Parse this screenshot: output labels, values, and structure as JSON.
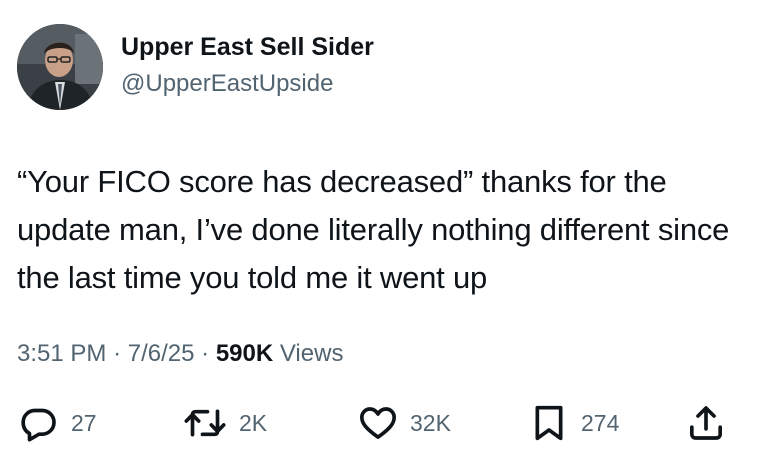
{
  "author": {
    "display_name": "Upper East Sell Sider",
    "handle": "@UpperEastUpside"
  },
  "tweet": {
    "text": "“Your FICO score has decreased” thanks for the update man, I’ve done literally nothing different since the last time you told me it went up",
    "time": "3:51 PM",
    "date": "7/6/25",
    "views_count": "590K",
    "views_label": "Views",
    "separator": "·"
  },
  "actions": {
    "reply_count": "27",
    "retweet_count": "2K",
    "like_count": "32K",
    "bookmark_count": "274"
  },
  "icons": {
    "reply": "reply-icon",
    "retweet": "retweet-icon",
    "like": "heart-icon",
    "bookmark": "bookmark-icon",
    "share": "share-icon"
  },
  "colors": {
    "text_primary": "#0f1419",
    "text_secondary": "#536471"
  }
}
